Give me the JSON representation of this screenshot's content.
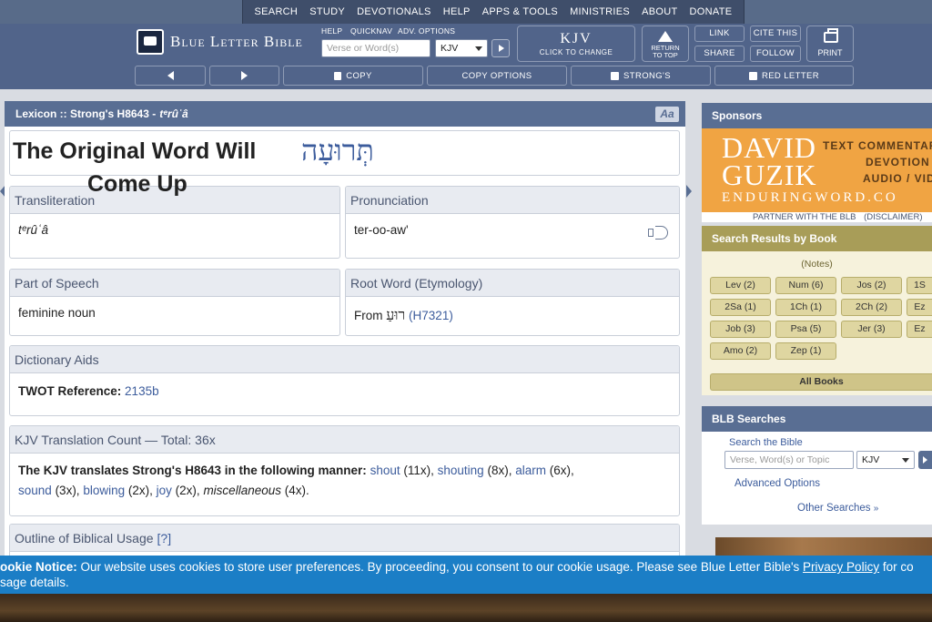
{
  "topnav": {
    "items": [
      "SEARCH",
      "STUDY",
      "DEVOTIONALS",
      "HELP",
      "APPS & TOOLS",
      "MINISTRIES",
      "ABOUT",
      "DONATE"
    ]
  },
  "header": {
    "logo_text": "Blue Letter Bible",
    "mini_links": [
      "HELP",
      "QUICKNAV",
      "ADV. OPTIONS"
    ],
    "search_placeholder": "Verse or Word(s)",
    "version": "KJV",
    "kjv_big": "KJV",
    "kjv_small": "CLICK TO CHANGE",
    "return_top": [
      "RETURN",
      "TO TOP"
    ],
    "link": "LINK",
    "share": "SHARE",
    "cite": "CITE THIS",
    "follow": "FOLLOW",
    "print": "PRINT",
    "copy": "COPY",
    "copy_options": "COPY OPTIONS",
    "strongs": "STRONG'S",
    "red_letter": "RED LETTER"
  },
  "lexicon": {
    "head_label": "Lexicon :: Strong's H8643 -",
    "head_translit": "tᵉrûʿâ",
    "aa": "Aa",
    "overlay_line1": "The  Original Word Will",
    "overlay_line2": "Come Up",
    "hebrew": "תְּרוּעָה",
    "transliteration_label": "Transliteration",
    "transliteration_value": "tᵉrûʿâ",
    "pronunciation_label": "Pronunciation",
    "pronunciation_value": "ter-oo-aw'",
    "pos_label": "Part of Speech",
    "pos_value": "feminine noun",
    "root_label": "Root Word (Etymology)",
    "root_from": "From",
    "root_hebrew": "רוּעַ",
    "root_link": "(H7321)",
    "dict_label": "Dictionary Aids",
    "twot_label": "TWOT Reference:",
    "twot_value": "2135b",
    "kjv_count_label": "KJV Translation Count — Total: 36x",
    "kjv_intro": "The KJV translates Strong's H8643 in the following manner:",
    "tr": [
      {
        "word": "shout",
        "count": "(11x),"
      },
      {
        "word": "shouting",
        "count": "(8x),"
      },
      {
        "word": "alarm",
        "count": "(6x),"
      },
      {
        "word": "sound",
        "count": "(3x),"
      },
      {
        "word": "blowing",
        "count": "(2x),"
      },
      {
        "word": "joy",
        "count": "(2x),"
      }
    ],
    "misc": "miscellaneous",
    "misc_count": "(4x).",
    "outline_label": "Outline of Biblical Usage",
    "outline_help": "[?]"
  },
  "sponsors": {
    "head": "Sponsors",
    "name_line1": "DAVID",
    "name_line2": "GUZIK",
    "tags": [
      "TEXT COMMENTAR",
      "DEVOTION",
      "AUDIO / VID"
    ],
    "site": "ENDURINGWORD.CO",
    "partner": "PARTNER WITH THE BLB",
    "disclaimer": "(DISCLAIMER)"
  },
  "search_by_book": {
    "head": "Search Results by Book",
    "notes": "(Notes)",
    "books": [
      "Lev (2)",
      "Num (6)",
      "Jos (2)",
      "1S",
      "2Sa (1)",
      "1Ch (1)",
      "2Ch (2)",
      "Ez",
      "Job (3)",
      "Psa (5)",
      "Jer (3)",
      "Ez",
      "Amo (2)",
      "Zep (1)"
    ],
    "all_books": "All Books"
  },
  "blb_searches": {
    "head": "BLB Searches",
    "search_label": "Search the Bible",
    "placeholder": "Verse, Word(s) or Topic",
    "version": "KJV",
    "advanced": "Advanced Options",
    "other": "Other Searches"
  },
  "cookie": {
    "lead": "ookie Notice:",
    "text": " Our website uses cookies to store user preferences. By proceeding, you consent to our cookie usage. Please see Blue Letter Bible's ",
    "privacy": "Privacy Policy",
    "tail": " for co",
    "line2": "sage details."
  }
}
